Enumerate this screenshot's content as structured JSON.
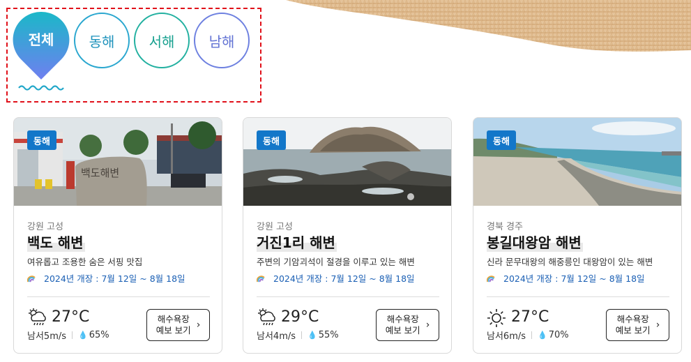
{
  "region_filter": {
    "tabs": [
      {
        "label": "전체",
        "active": true
      },
      {
        "label": "동해",
        "active": false
      },
      {
        "label": "서해",
        "active": false
      },
      {
        "label": "남해",
        "active": false
      }
    ]
  },
  "cards": [
    {
      "tag": "동해",
      "region": "강원 고성",
      "name": "백도 해변",
      "description": "여유롭고 조용한 숨은 서핑 맛집",
      "open_period": "2024년 개장 : 7월 12일 ~ 8월 18일",
      "weather_icon": "rain-cloud-icon",
      "temperature": "27°C",
      "wind": "남서5m/s",
      "humidity": "65%",
      "forecast_button": [
        "해수욕장",
        "예보 보기"
      ],
      "photo_sign_text": "백도해변"
    },
    {
      "tag": "동해",
      "region": "강원 고성",
      "name": "거진1리 해변",
      "description": "주변의 기암괴석이 절경을 이루고 있는 해변",
      "open_period": "2024년 개장 : 7월 12일 ~ 8월 18일",
      "weather_icon": "rain-cloud-icon",
      "temperature": "29°C",
      "wind": "남서4m/s",
      "humidity": "55%",
      "forecast_button": [
        "해수욕장",
        "예보 보기"
      ]
    },
    {
      "tag": "동해",
      "region": "경북 경주",
      "name": "봉길대왕암 해변",
      "description": "신라 문무대왕의 해중릉인 대왕암이 있는 해변",
      "open_period": "2024년 개장 : 7월 12일 ~ 8월 18일",
      "weather_icon": "sun-icon",
      "temperature": "27°C",
      "wind": "남서6m/s",
      "humidity": "70%",
      "forecast_button": [
        "해수욕장",
        "예보 보기"
      ]
    }
  ],
  "colors": {
    "tag_bg": "#1377c9",
    "active_tab_gradient": [
      "#1bb8c8",
      "#6f7ff0"
    ],
    "highlight_box": "#e0111a",
    "open_period_text": "#1a5fb4"
  }
}
